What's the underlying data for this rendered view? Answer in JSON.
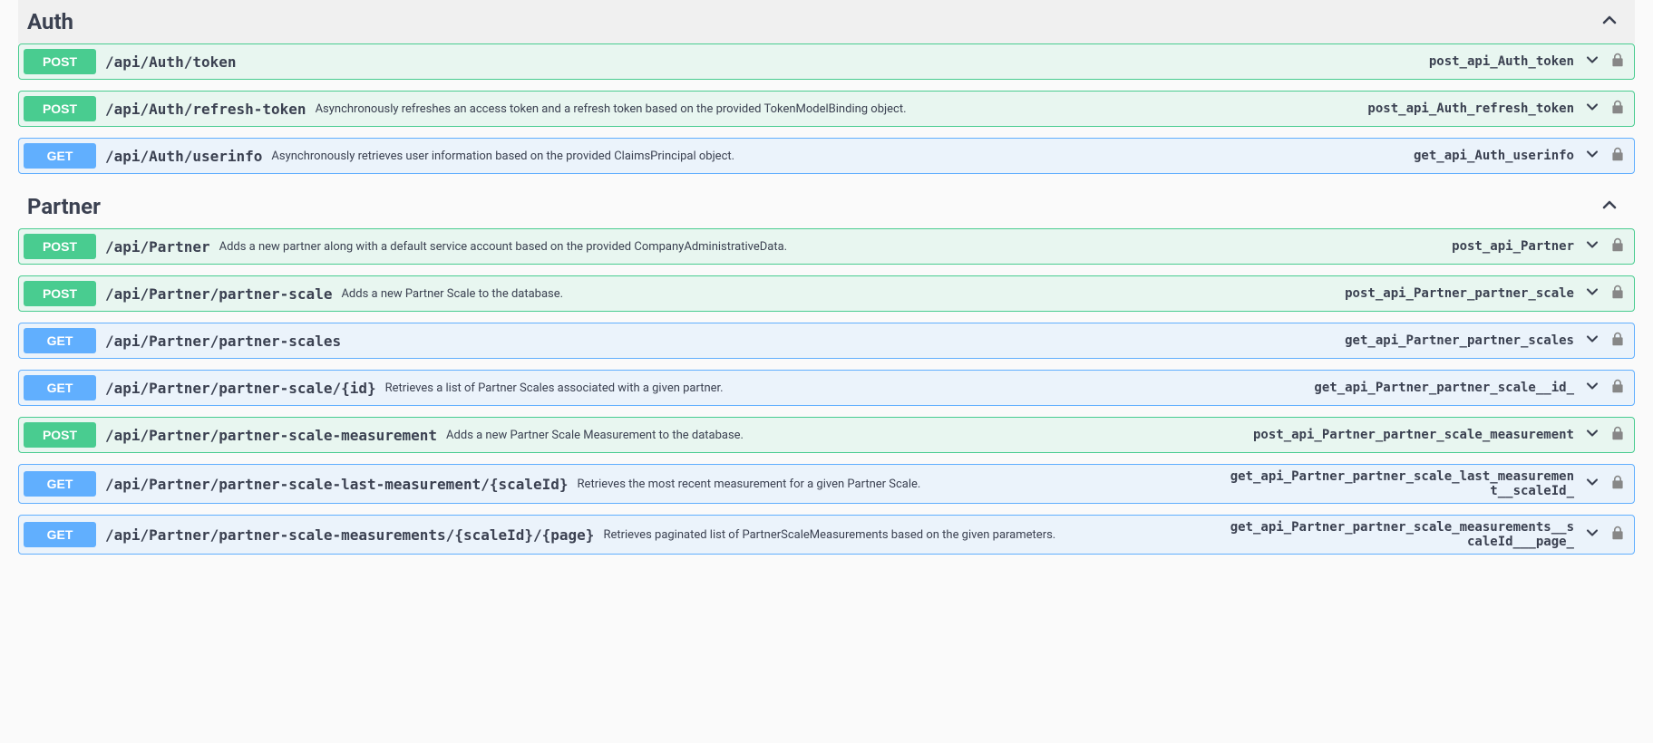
{
  "tags": [
    {
      "name": "Auth",
      "expanded": true,
      "ops": [
        {
          "method": "POST",
          "path": "/api/Auth/token",
          "desc": "",
          "opId": "post_api_Auth_token"
        },
        {
          "method": "POST",
          "path": "/api/Auth/refresh-token",
          "desc": "Asynchronously refreshes an access token and a refresh token based on the provided TokenModelBinding object.",
          "opId": "post_api_Auth_refresh_token"
        },
        {
          "method": "GET",
          "path": "/api/Auth/userinfo",
          "desc": "Asynchronously retrieves user information based on the provided ClaimsPrincipal object.",
          "opId": "get_api_Auth_userinfo"
        }
      ]
    },
    {
      "name": "Partner",
      "expanded": true,
      "ops": [
        {
          "method": "POST",
          "path": "/api/Partner",
          "desc": "Adds a new partner along with a default service account based on the provided CompanyAdministrativeData.",
          "opId": "post_api_Partner"
        },
        {
          "method": "POST",
          "path": "/api/Partner/partner-scale",
          "desc": "Adds a new Partner Scale to the database.",
          "opId": "post_api_Partner_partner_scale"
        },
        {
          "method": "GET",
          "path": "/api/Partner/partner-scales",
          "desc": "",
          "opId": "get_api_Partner_partner_scales"
        },
        {
          "method": "GET",
          "path": "/api/Partner/partner-scale/{id}",
          "desc": "Retrieves a list of Partner Scales associated with a given partner.",
          "opId": "get_api_Partner_partner_scale__id_"
        },
        {
          "method": "POST",
          "path": "/api/Partner/partner-scale-measurement",
          "desc": "Adds a new Partner Scale Measurement to the database.",
          "opId": "post_api_Partner_partner_scale_measurement"
        },
        {
          "method": "GET",
          "path": "/api/Partner/partner-scale-last-measurement/{scaleId}",
          "desc": "Retrieves the most recent measurement for a given Partner Scale.",
          "opId": "get_api_Partner_partner_scale_last_measurement__scaleId_"
        },
        {
          "method": "GET",
          "path": "/api/Partner/partner-scale-measurements/{scaleId}/{page}",
          "desc": "Retrieves paginated list of PartnerScaleMeasurements based on the given parameters.",
          "opId": "get_api_Partner_partner_scale_measurements__scaleId___page_"
        }
      ]
    }
  ]
}
